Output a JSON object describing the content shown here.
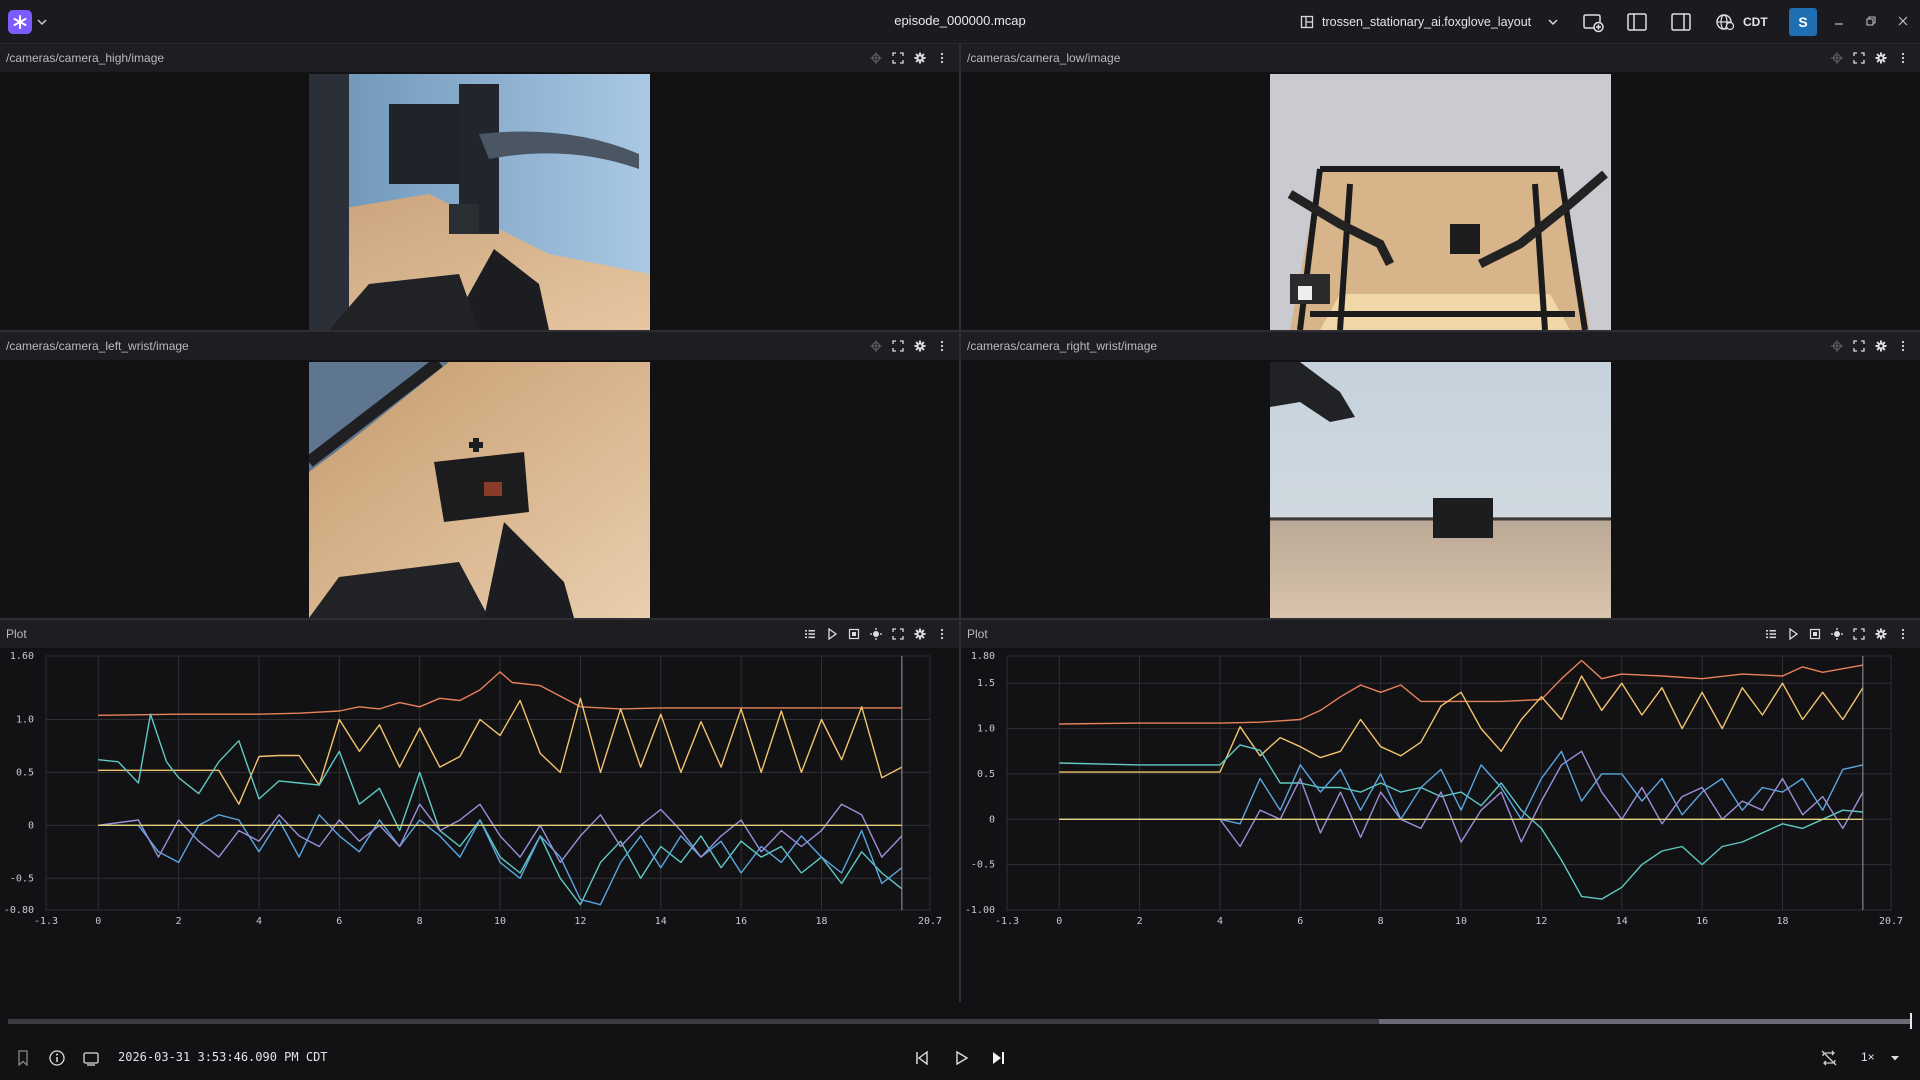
{
  "app": {
    "file_title": "episode_000000.mcap",
    "layout_name": "trossen_stationary_ai.foxglove_layout",
    "timezone": "CDT",
    "user_initial": "S",
    "brand_color": "#7c5cff",
    "avatar_color": "#1f6fb2"
  },
  "toolbar_icons": [
    "add-panel-icon",
    "left-sidebar-icon",
    "right-sidebar-icon",
    "timezone-globe-icon"
  ],
  "panels": [
    {
      "title": "/cameras/camera_high/image",
      "scene": "high"
    },
    {
      "title": "/cameras/camera_low/image",
      "scene": "low"
    },
    {
      "title": "/cameras/camera_left_wrist/image",
      "scene": "left"
    },
    {
      "title": "/cameras/camera_right_wrist/image",
      "scene": "right"
    },
    {
      "title": "Plot"
    },
    {
      "title": "Plot"
    }
  ],
  "playback": {
    "timestamp": "2026-03-31 3:53:46.090 PM CDT",
    "speed": "1×",
    "progress": 1.0,
    "buffered_from": 0.72
  },
  "chart_data": [
    {
      "type": "line",
      "title": "",
      "xlim": [
        -1.3,
        20.7
      ],
      "ylim": [
        -0.8,
        1.6
      ],
      "x_ticks": [
        "-1.3",
        "0",
        "2",
        "4",
        "6",
        "8",
        "10",
        "12",
        "14",
        "16",
        "18",
        "20.7"
      ],
      "x_tick_values": [
        -1.3,
        0,
        2,
        4,
        6,
        8,
        10,
        12,
        14,
        16,
        18,
        20.7
      ],
      "y_ticks": [
        "1.60",
        "1.0",
        "0.5",
        "0",
        "-0.5",
        "-0.80"
      ],
      "y_tick_values": [
        1.6,
        1.0,
        0.5,
        0,
        -0.5,
        -0.8
      ],
      "cursor_x": 20.0,
      "grid": true,
      "series": [
        {
          "color": "#e8825a",
          "x": [
            0,
            2,
            4,
            5,
            6,
            6.5,
            7,
            7.5,
            8,
            8.5,
            9,
            9.5,
            10,
            10.3,
            11,
            12,
            13,
            14,
            15,
            16,
            17,
            18,
            19,
            20
          ],
          "y": [
            1.04,
            1.05,
            1.05,
            1.06,
            1.08,
            1.12,
            1.1,
            1.16,
            1.12,
            1.2,
            1.18,
            1.28,
            1.45,
            1.35,
            1.32,
            1.12,
            1.1,
            1.11,
            1.11,
            1.11,
            1.11,
            1.11,
            1.11,
            1.11
          ]
        },
        {
          "color": "#f2c46e",
          "x": [
            0,
            1,
            3,
            3.5,
            4,
            4.5,
            5,
            5.5,
            6,
            6.5,
            7,
            7.5,
            8,
            8.5,
            9,
            9.5,
            10,
            10.5,
            11,
            11.5,
            12,
            12.5,
            13,
            13.5,
            14,
            14.5,
            15,
            15.5,
            16,
            16.5,
            17,
            17.5,
            18,
            18.5,
            19,
            19.5,
            20
          ],
          "y": [
            0.52,
            0.52,
            0.52,
            0.2,
            0.65,
            0.66,
            0.66,
            0.38,
            1.0,
            0.7,
            0.95,
            0.55,
            0.92,
            0.55,
            0.65,
            1.0,
            0.85,
            1.18,
            0.68,
            0.5,
            1.2,
            0.5,
            1.1,
            0.55,
            1.05,
            0.5,
            0.98,
            0.55,
            1.1,
            0.5,
            1.08,
            0.5,
            1.0,
            0.62,
            1.12,
            0.45,
            0.55
          ]
        },
        {
          "color": "#5fc9c4",
          "x": [
            0,
            0.5,
            1,
            1.3,
            1.7,
            2,
            2.5,
            3,
            3.5,
            4,
            4.5,
            5,
            5.5,
            6,
            6.5,
            7,
            7.5,
            8,
            8.5,
            9,
            9.5,
            10,
            10.5,
            11,
            11.5,
            12,
            12.5,
            13,
            13.5,
            14,
            14.5,
            15,
            15.5,
            16,
            16.5,
            17,
            17.5,
            18,
            18.5,
            19,
            19.5,
            20
          ],
          "y": [
            0.62,
            0.6,
            0.4,
            1.05,
            0.6,
            0.45,
            0.3,
            0.6,
            0.8,
            0.25,
            0.42,
            0.4,
            0.38,
            0.7,
            0.2,
            0.35,
            -0.05,
            0.5,
            -0.05,
            -0.2,
            0.05,
            -0.3,
            -0.45,
            -0.1,
            -0.5,
            -0.75,
            -0.35,
            -0.15,
            -0.5,
            -0.2,
            -0.35,
            -0.1,
            -0.4,
            -0.15,
            -0.3,
            -0.2,
            -0.45,
            -0.3,
            -0.55,
            -0.25,
            -0.45,
            -0.6
          ]
        },
        {
          "color": "#5aa6e0",
          "x": [
            0,
            1,
            1.5,
            2,
            2.5,
            3,
            3.5,
            4,
            4.5,
            5,
            5.5,
            6,
            6.5,
            7,
            7.5,
            8,
            8.5,
            9,
            9.5,
            10,
            10.5,
            11,
            11.5,
            12,
            12.5,
            13,
            13.5,
            14,
            14.5,
            15,
            15.5,
            16,
            16.5,
            17,
            17.5,
            18,
            18.5,
            19,
            19.5,
            20
          ],
          "y": [
            0,
            0,
            -0.25,
            -0.35,
            0.0,
            0.1,
            0.05,
            -0.25,
            0.05,
            -0.3,
            0.1,
            -0.1,
            -0.25,
            0.05,
            -0.2,
            0.05,
            -0.1,
            -0.3,
            0.05,
            -0.35,
            -0.5,
            -0.1,
            -0.3,
            -0.7,
            -0.75,
            -0.35,
            -0.1,
            -0.4,
            -0.1,
            -0.3,
            -0.15,
            -0.45,
            -0.2,
            -0.35,
            -0.1,
            -0.3,
            -0.45,
            -0.05,
            -0.55,
            -0.4
          ]
        },
        {
          "color": "#9b8fd8",
          "x": [
            0,
            1,
            1.5,
            2,
            2.5,
            3,
            3.5,
            4,
            4.5,
            5,
            5.5,
            6,
            6.5,
            7,
            7.5,
            8,
            8.5,
            9,
            9.5,
            10,
            10.5,
            11,
            11.5,
            12,
            12.5,
            13,
            13.5,
            14,
            14.5,
            15,
            15.5,
            16,
            16.5,
            17,
            17.5,
            18,
            18.5,
            19,
            19.5,
            20
          ],
          "y": [
            0,
            0.05,
            -0.3,
            0.05,
            -0.15,
            -0.3,
            -0.05,
            -0.15,
            0.1,
            -0.1,
            -0.2,
            0.05,
            -0.15,
            0.0,
            -0.2,
            0.2,
            -0.05,
            0.05,
            0.2,
            -0.1,
            -0.3,
            0.0,
            -0.35,
            -0.1,
            0.1,
            -0.2,
            0.0,
            0.15,
            -0.05,
            -0.3,
            -0.1,
            0.05,
            -0.25,
            -0.05,
            -0.2,
            -0.05,
            0.2,
            0.1,
            -0.3,
            -0.1
          ]
        },
        {
          "color": "#e3d27a",
          "x": [
            0,
            20
          ],
          "y": [
            0,
            0
          ]
        }
      ]
    },
    {
      "type": "line",
      "title": "",
      "xlim": [
        -1.3,
        20.7
      ],
      "ylim": [
        -1.0,
        1.8
      ],
      "x_ticks": [
        "-1.3",
        "0",
        "2",
        "4",
        "6",
        "8",
        "10",
        "12",
        "14",
        "16",
        "18",
        "20.7"
      ],
      "x_tick_values": [
        -1.3,
        0,
        2,
        4,
        6,
        8,
        10,
        12,
        14,
        16,
        18,
        20.7
      ],
      "y_ticks": [
        "1.80",
        "1.5",
        "1.0",
        "0.5",
        "0",
        "-0.5",
        "-1.00"
      ],
      "y_tick_values": [
        1.8,
        1.5,
        1.0,
        0.5,
        0,
        -0.5,
        -1.0
      ],
      "cursor_x": 20.0,
      "grid": true,
      "series": [
        {
          "color": "#e8825a",
          "x": [
            0,
            2,
            4,
            5,
            6,
            6.5,
            7,
            7.5,
            8,
            8.5,
            9,
            10,
            11,
            12,
            12.5,
            13,
            13.5,
            14,
            15,
            16,
            17,
            18,
            18.5,
            19,
            20
          ],
          "y": [
            1.05,
            1.06,
            1.06,
            1.07,
            1.1,
            1.2,
            1.35,
            1.48,
            1.4,
            1.48,
            1.3,
            1.3,
            1.3,
            1.32,
            1.55,
            1.75,
            1.55,
            1.6,
            1.58,
            1.55,
            1.6,
            1.58,
            1.68,
            1.62,
            1.7
          ]
        },
        {
          "color": "#f2c46e",
          "x": [
            0,
            1,
            4,
            4.5,
            5,
            5.5,
            6,
            6.5,
            7,
            7.5,
            8,
            8.5,
            9,
            9.5,
            10,
            10.5,
            11,
            11.5,
            12,
            12.5,
            13,
            13.5,
            14,
            14.5,
            15,
            15.5,
            16,
            16.5,
            17,
            17.5,
            18,
            18.5,
            19,
            19.5,
            20
          ],
          "y": [
            0.52,
            0.52,
            0.52,
            1.02,
            0.7,
            0.9,
            0.8,
            0.68,
            0.75,
            1.1,
            0.8,
            0.7,
            0.85,
            1.25,
            1.4,
            1.0,
            0.75,
            1.1,
            1.35,
            1.1,
            1.58,
            1.2,
            1.5,
            1.15,
            1.45,
            1.0,
            1.4,
            1.0,
            1.45,
            1.15,
            1.5,
            1.1,
            1.4,
            1.1,
            1.45
          ]
        },
        {
          "color": "#5fc9c4",
          "x": [
            0,
            2,
            4,
            4.5,
            5,
            5.5,
            6,
            6.5,
            7,
            7.5,
            8,
            8.5,
            9,
            9.5,
            10,
            10.5,
            11,
            11.5,
            12,
            12.5,
            13,
            13.5,
            14,
            14.5,
            15,
            15.5,
            16,
            16.5,
            17,
            17.5,
            18,
            18.5,
            19,
            19.5,
            20
          ],
          "y": [
            0.62,
            0.6,
            0.6,
            0.82,
            0.76,
            0.4,
            0.4,
            0.35,
            0.35,
            0.3,
            0.4,
            0.3,
            0.35,
            0.25,
            0.3,
            0.15,
            0.4,
            0.1,
            -0.1,
            -0.45,
            -0.85,
            -0.88,
            -0.75,
            -0.5,
            -0.35,
            -0.3,
            -0.5,
            -0.3,
            -0.25,
            -0.15,
            -0.05,
            -0.1,
            0.0,
            0.1,
            0.08
          ]
        },
        {
          "color": "#5aa6e0",
          "x": [
            0,
            2,
            4,
            4.5,
            5,
            5.5,
            6,
            6.5,
            7,
            7.5,
            8,
            8.5,
            9,
            9.5,
            10,
            10.5,
            11,
            11.5,
            12,
            12.5,
            13,
            13.5,
            14,
            14.5,
            15,
            15.5,
            16,
            16.5,
            17,
            17.5,
            18,
            18.5,
            19,
            19.5,
            20
          ],
          "y": [
            0,
            0,
            0,
            -0.05,
            0.45,
            0.1,
            0.6,
            0.3,
            0.55,
            0.1,
            0.5,
            0.0,
            0.35,
            0.55,
            0.1,
            0.6,
            0.35,
            0.0,
            0.45,
            0.75,
            0.2,
            0.5,
            0.5,
            0.2,
            0.45,
            0.05,
            0.3,
            0.45,
            0.1,
            0.35,
            0.3,
            0.45,
            0.1,
            0.55,
            0.6
          ]
        },
        {
          "color": "#9b8fd8",
          "x": [
            0,
            2,
            4,
            4.5,
            5,
            5.5,
            6,
            6.5,
            7,
            7.5,
            8,
            8.5,
            9,
            9.5,
            10,
            10.5,
            11,
            11.5,
            12,
            12.5,
            13,
            13.5,
            14,
            14.5,
            15,
            15.5,
            16,
            16.5,
            17,
            17.5,
            18,
            18.5,
            19,
            19.5,
            20
          ],
          "y": [
            0,
            0,
            0,
            -0.3,
            0.1,
            0.0,
            0.45,
            -0.15,
            0.3,
            -0.2,
            0.3,
            0.0,
            -0.1,
            0.3,
            -0.25,
            0.1,
            0.3,
            -0.25,
            0.2,
            0.6,
            0.75,
            0.3,
            0.0,
            0.35,
            -0.05,
            0.25,
            0.35,
            0.0,
            0.2,
            0.1,
            0.45,
            0.05,
            0.25,
            -0.1,
            0.3
          ]
        },
        {
          "color": "#e3d27a",
          "x": [
            0,
            20
          ],
          "y": [
            0,
            0
          ]
        }
      ]
    }
  ]
}
